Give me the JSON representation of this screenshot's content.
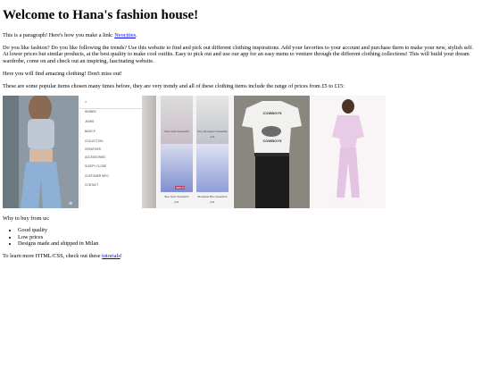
{
  "header": {
    "title": "Welcome to Hana's fashion house!"
  },
  "intro": {
    "text_before_link": "This is a paragraph! Here's how you make a link: ",
    "link_label": "Neocities",
    "text_after_link": "."
  },
  "about": {
    "text": "Do you like fashion? Do you like following the trends? Use this website to find and pick out different clothing inspirations. Add your favorites to your account and purchase them to make your new, stylish self. At lower prices but similar products, at the best quality to make cool outfits. Easy to pick out and use our app for an easy menu to venture through the different clothing collections! This will build your dream wardrobe, come on and check out an inspiring, fascinating website."
  },
  "teaser": {
    "text": "Here you will find amazing clothing! Don't miss out!"
  },
  "popular": {
    "text": "These are some popular items chosen many times before, they are very trendy and all of these clothing items include the range of prices from £5 to £15:"
  },
  "gallery": {
    "menu_items": [
      "WOMEN",
      "JEANS",
      "BASICS",
      "COLLECTION",
      "CREATIVES",
      "ACCESSORIES",
      "SLEEPY CLOSE",
      "CUSTOMER INFO",
      "CONTACT"
    ],
    "card_captions": [
      "Ultra Violet Sweatshirt",
      "Grey Springtime Sweatshirt",
      "Blue Swim Sweatshirt",
      "Brookland Blue Sweatshirt"
    ],
    "card_prices": [
      "£10",
      "£10",
      "£12",
      "£12"
    ],
    "badge_label": "NEW IN",
    "tee_text_top": "COWBOYS",
    "tee_text_bottom": "COWBOYS"
  },
  "reasons": {
    "heading": "Why to buy from us:",
    "items": [
      "Good quality",
      "Low prices",
      "Designs made and shipped in Milan"
    ]
  },
  "footer": {
    "text_before_link": "To learn more HTML/CSS, check out these ",
    "link_label": "tutorials",
    "text_after_link": "!"
  }
}
